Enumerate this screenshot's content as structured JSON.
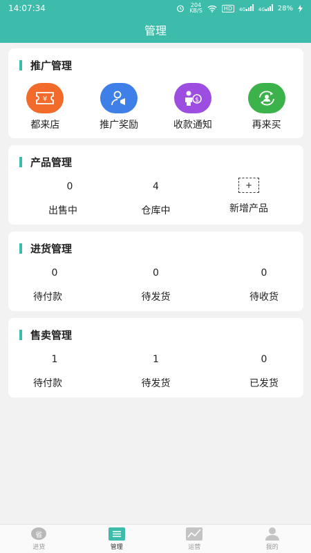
{
  "status": {
    "time": "14:07:34",
    "net_speed_value": "204",
    "net_speed_unit": "KB/S",
    "hd": "HD",
    "signal1": "4G",
    "signal2": "4G",
    "battery": "28%"
  },
  "header": {
    "title": "管理"
  },
  "promotion": {
    "title": "推广管理",
    "items": [
      {
        "label": "都来店",
        "icon": "ticket-icon",
        "color": "#f26b2a"
      },
      {
        "label": "推广奖励",
        "icon": "person-megaphone-icon",
        "color": "#3f7fe8"
      },
      {
        "label": "收款通知",
        "icon": "person-money-icon",
        "color": "#9d4ee0"
      },
      {
        "label": "再来买",
        "icon": "person-refresh-icon",
        "color": "#3cb34a"
      }
    ]
  },
  "products": {
    "title": "产品管理",
    "on_sale": {
      "value": "0",
      "label": "出售中"
    },
    "warehouse": {
      "value": "4",
      "label": "仓库中"
    },
    "add": {
      "symbol": "+",
      "label": "新增产品"
    }
  },
  "purchase": {
    "title": "进货管理",
    "stats": [
      {
        "value": "0",
        "label": "待付款"
      },
      {
        "value": "0",
        "label": "待发货"
      },
      {
        "value": "0",
        "label": "待收货"
      }
    ]
  },
  "sales": {
    "title": "售卖管理",
    "stats": [
      {
        "value": "1",
        "label": "待付款"
      },
      {
        "value": "1",
        "label": "待发货"
      },
      {
        "value": "0",
        "label": "已发货"
      }
    ]
  },
  "tabbar": {
    "items": [
      {
        "label": "进货",
        "icon_char": "省",
        "icon": "sheng-icon"
      },
      {
        "label": "管理",
        "icon": "menu-icon",
        "active": true
      },
      {
        "label": "运营",
        "icon": "chart-icon"
      },
      {
        "label": "我的",
        "icon": "user-icon"
      }
    ]
  },
  "colors": {
    "accent": "#3dbcab"
  }
}
